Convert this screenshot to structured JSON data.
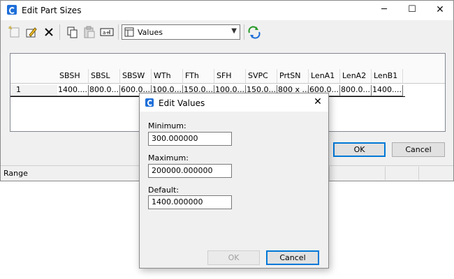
{
  "main_window": {
    "title": "Edit Part Sizes",
    "caption": {
      "minimize": "─",
      "maximize": "☐",
      "close": "✕"
    },
    "toolbar": {
      "buttons": [
        "new-icon",
        "edit-icon",
        "delete-icon",
        "copy-icon",
        "paste-icon",
        "rename-icon",
        "refresh-icon"
      ],
      "combo": {
        "selected": "Values"
      }
    },
    "grid": {
      "columns": [
        "SBSH",
        "SBSL",
        "SBSW",
        "WTh",
        "FTh",
        "SFH",
        "SVPC",
        "PrtSN",
        "LenA1",
        "LenA2",
        "LenB1"
      ],
      "rows": [
        {
          "header": "1",
          "cells": [
            "1400....",
            "800.0...",
            "600.0...",
            "100.0...",
            "150.0...",
            "100.0...",
            "150.0...",
            "800 x ...",
            "600.0...",
            "800.0...",
            "1400...."
          ]
        }
      ]
    },
    "buttons": {
      "ok": "OK",
      "cancel": "Cancel"
    },
    "statusbar": {
      "text": "Range"
    }
  },
  "dialog": {
    "title": "Edit Values",
    "close": "✕",
    "fields": {
      "minimum": {
        "label": "Minimum:",
        "value": "300.000000"
      },
      "maximum": {
        "label": "Maximum:",
        "value": "200000.000000"
      },
      "default": {
        "label": "Default:",
        "value": "1400.000000"
      }
    },
    "buttons": {
      "ok": "OK",
      "cancel": "Cancel"
    }
  },
  "colors": {
    "accent": "#0078d7",
    "app_icon": "#1e6fd9",
    "window_bg": "#f0f0f0"
  }
}
